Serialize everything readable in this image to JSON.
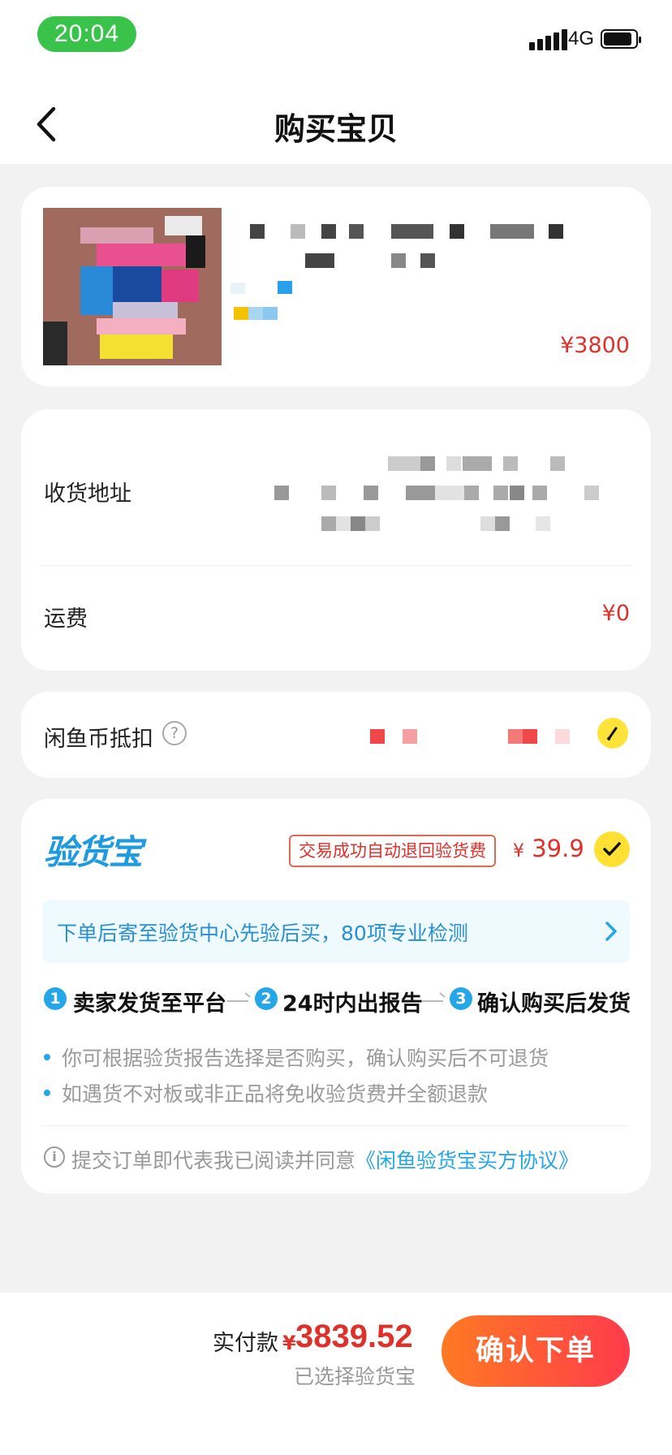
{
  "status_bar": {
    "time": "20:04",
    "network": "4G"
  },
  "nav": {
    "title": "购买宝贝"
  },
  "product": {
    "price": "¥3800"
  },
  "shipping": {
    "address_label": "收货地址",
    "fee_label": "运费",
    "fee_value": "¥0"
  },
  "coins": {
    "label": "闲鱼币抵扣",
    "help": "?"
  },
  "inspection": {
    "logo": "验货宝",
    "refund_tag": "交易成功自动退回验货费",
    "fee_symbol": "¥",
    "fee": "39.9",
    "banner": "下单后寄至验货中心先验后买，80项专业检测",
    "steps": [
      {
        "num": "1",
        "label": "卖家发货至平台"
      },
      {
        "num": "2",
        "label": "24时内出报告"
      },
      {
        "num": "3",
        "label": "确认购买后发货"
      }
    ],
    "notes": [
      "你可根据验货报告选择是否购买，确认购买后不可退货",
      "如遇货不对板或非正品将免收验货费并全额退款"
    ],
    "agreement_prefix": "提交订单即代表我已阅读并同意",
    "agreement_link": "《闲鱼验货宝买方协议》"
  },
  "footer": {
    "pay_label": "实付款",
    "yen": "¥",
    "amount": "3839.52",
    "sub": "已选择验货宝",
    "confirm": "确认下单"
  },
  "colors": {
    "accent_red": "#e0302a",
    "accent_blue": "#25a6e8",
    "button_start": "#ff7a22",
    "button_end": "#ff3b4c"
  }
}
